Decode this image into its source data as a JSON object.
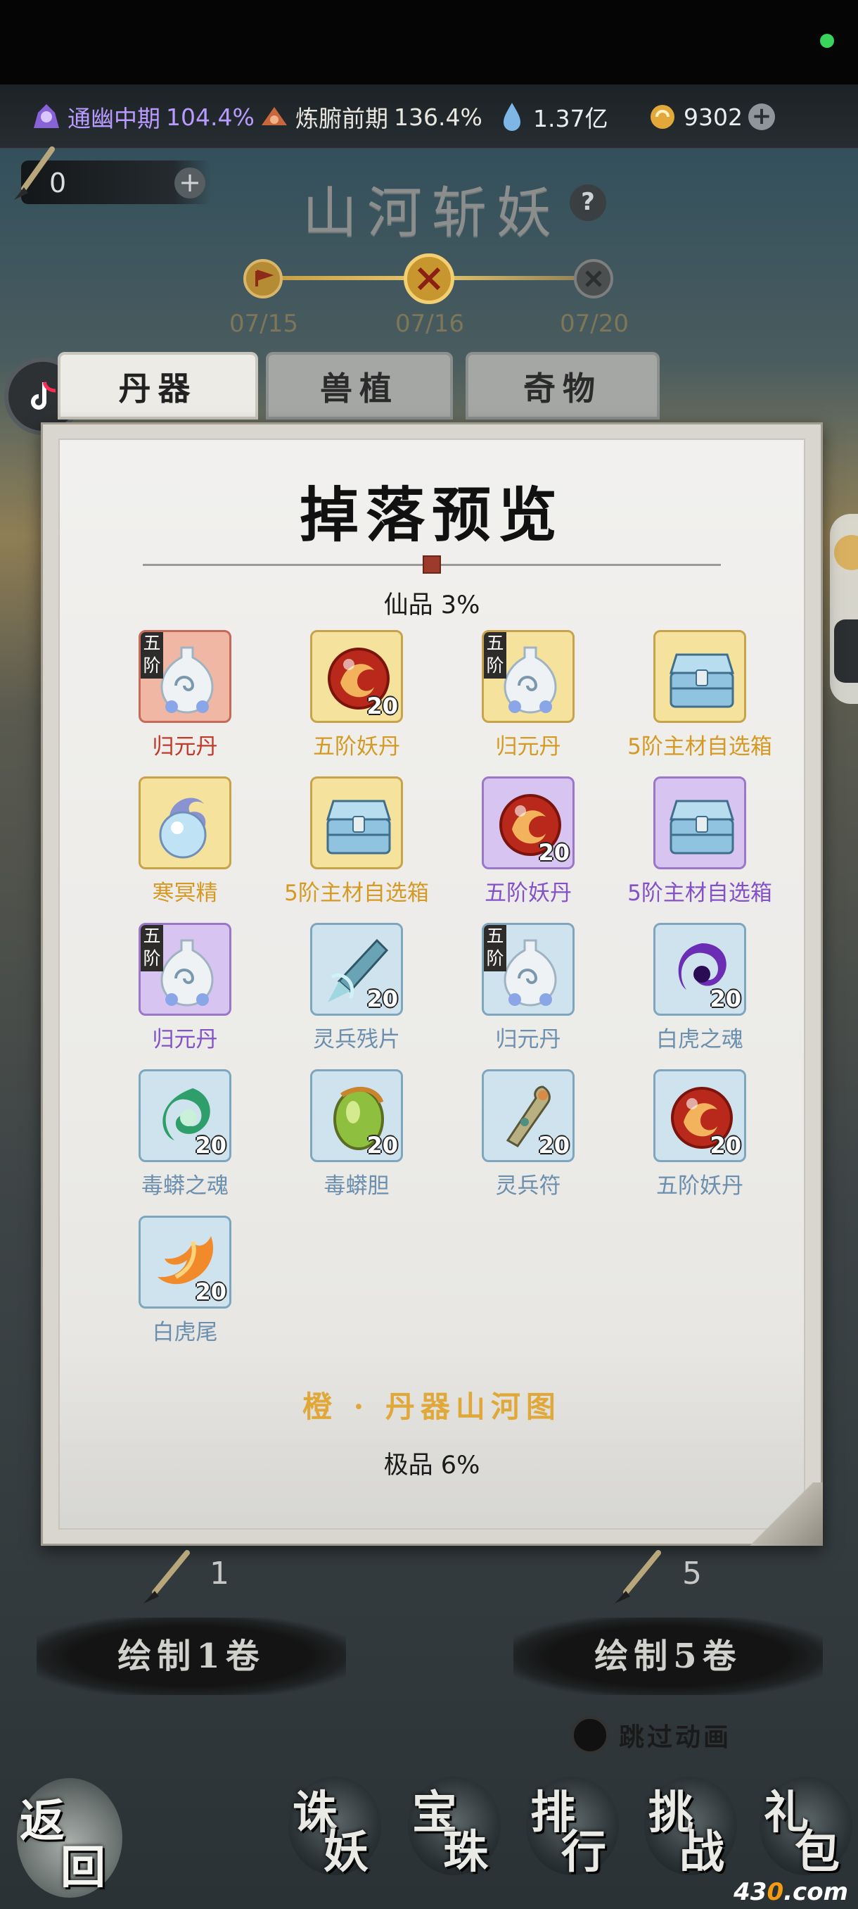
{
  "resources": [
    {
      "icon": "ghost-realm-icon",
      "name": "通幽中期",
      "pct": "104.4%"
    },
    {
      "icon": "body-refine-icon",
      "name": "炼腑前期",
      "pct": "136.4%"
    },
    {
      "icon": "spirit-drop-icon",
      "value": "1.37亿"
    },
    {
      "icon": "gold-coin-icon",
      "value": "9302"
    }
  ],
  "brush_counter": "0",
  "event_title": "山河斩妖",
  "timeline": [
    "07/15",
    "07/16",
    "07/20"
  ],
  "tabs": [
    "丹器",
    "兽植",
    "奇物"
  ],
  "panel": {
    "title": "掉落预览",
    "tier1_label": "仙品 3%",
    "tier2_label": "极品 6%",
    "scroll_name": "橙 · 丹器山河图"
  },
  "items": [
    {
      "name": "归元丹",
      "rarity": "red",
      "tier_badge": "五阶",
      "qty": "",
      "icon": "gourd-flask-icon"
    },
    {
      "name": "五阶妖丹",
      "rarity": "gold",
      "tier_badge": "",
      "qty": "20",
      "icon": "demon-core-icon"
    },
    {
      "name": "归元丹",
      "rarity": "gold",
      "tier_badge": "五阶",
      "qty": "",
      "icon": "gourd-flask-icon"
    },
    {
      "name": "5阶主材自选箱",
      "rarity": "gold",
      "tier_badge": "",
      "qty": "",
      "icon": "treasure-chest-icon"
    },
    {
      "name": "寒冥精",
      "rarity": "gold",
      "tier_badge": "",
      "qty": "",
      "icon": "frost-orb-icon"
    },
    {
      "name": "5阶主材自选箱",
      "rarity": "gold",
      "tier_badge": "",
      "qty": "",
      "icon": "treasure-chest-icon"
    },
    {
      "name": "五阶妖丹",
      "rarity": "purple",
      "tier_badge": "",
      "qty": "20",
      "icon": "demon-core-icon"
    },
    {
      "name": "5阶主材自选箱",
      "rarity": "purple",
      "tier_badge": "",
      "qty": "",
      "icon": "treasure-chest-icon"
    },
    {
      "name": "归元丹",
      "rarity": "purple",
      "tier_badge": "五阶",
      "qty": "",
      "icon": "gourd-flask-icon"
    },
    {
      "name": "灵兵残片",
      "rarity": "blue",
      "tier_badge": "",
      "qty": "20",
      "icon": "sword-shard-icon"
    },
    {
      "name": "归元丹",
      "rarity": "blue",
      "tier_badge": "五阶",
      "qty": "",
      "icon": "gourd-flask-icon"
    },
    {
      "name": "白虎之魂",
      "rarity": "blue",
      "tier_badge": "",
      "qty": "20",
      "icon": "purple-soul-icon"
    },
    {
      "name": "毒蟒之魂",
      "rarity": "blue",
      "tier_badge": "",
      "qty": "20",
      "icon": "green-soul-icon"
    },
    {
      "name": "毒蟒胆",
      "rarity": "blue",
      "tier_badge": "",
      "qty": "20",
      "icon": "serpent-gall-icon"
    },
    {
      "name": "灵兵符",
      "rarity": "blue",
      "tier_badge": "",
      "qty": "20",
      "icon": "weapon-talisman-icon"
    },
    {
      "name": "五阶妖丹",
      "rarity": "blue",
      "tier_badge": "",
      "qty": "20",
      "icon": "demon-core-icon"
    },
    {
      "name": "白虎尾",
      "rarity": "blue",
      "tier_badge": "",
      "qty": "20",
      "icon": "tiger-tail-icon"
    }
  ],
  "draw": {
    "one": {
      "count": "1",
      "label": "绘制1卷"
    },
    "five": {
      "count": "5",
      "label": "绘制5卷"
    }
  },
  "skip_label": "跳过动画",
  "back_label": {
    "c1": "返",
    "c2": "回"
  },
  "nav": [
    {
      "c1": "诛",
      "c2": "妖"
    },
    {
      "c1": "宝",
      "c2": "珠"
    },
    {
      "c1": "排",
      "c2": "行"
    },
    {
      "c1": "挑",
      "c2": "战"
    },
    {
      "c1": "礼",
      "c2": "包"
    }
  ],
  "watermark": {
    "a": "43",
    "b": "0",
    "c": ".com"
  },
  "colors": {
    "red": "#c0392b",
    "gold": "#d49a23",
    "purple": "#8452c7",
    "blue": "#6b8fae"
  }
}
